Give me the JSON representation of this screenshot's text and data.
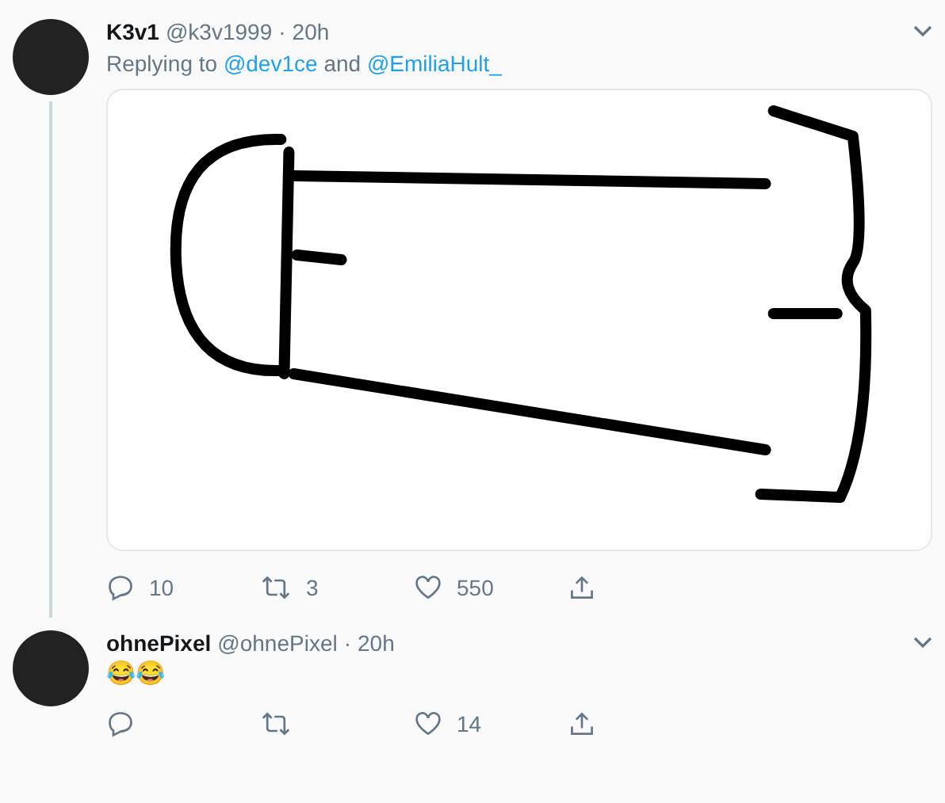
{
  "tweets": [
    {
      "name": "K3v1",
      "handle": "@k3v1999",
      "separator": "·",
      "time": "20h",
      "thread_line": true,
      "replying": [
        {
          "kind": "plain",
          "text": "Replying to"
        },
        {
          "kind": "link",
          "text": "@dev1ce"
        },
        {
          "kind": "plain",
          "text": "and"
        },
        {
          "kind": "link",
          "text": "@EmiliaHult_"
        }
      ],
      "media": {
        "kind": "drawing"
      },
      "actions": [
        {
          "kind": "reply",
          "count": "10"
        },
        {
          "kind": "retweet",
          "count": "3"
        },
        {
          "kind": "like",
          "count": "550"
        },
        {
          "kind": "share"
        }
      ]
    },
    {
      "name": "ohnePixel",
      "handle": "@ohnePixel",
      "separator": "·",
      "time": "20h",
      "thread_line": false,
      "text": "😂😂",
      "actions": [
        {
          "kind": "reply"
        },
        {
          "kind": "retweet"
        },
        {
          "kind": "like",
          "count": "14"
        },
        {
          "kind": "share"
        }
      ]
    }
  ]
}
